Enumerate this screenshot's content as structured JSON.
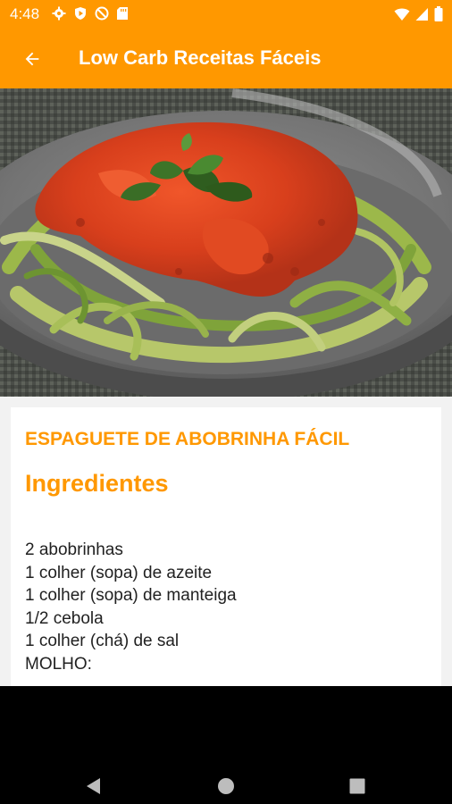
{
  "status_bar": {
    "time": "4:48",
    "left_icons": [
      "gear-icon",
      "shield-play-icon",
      "no-disturb-icon",
      "sd-card-icon"
    ],
    "right_icons": [
      "wifi-icon",
      "signal-icon",
      "battery-icon"
    ]
  },
  "app_bar": {
    "title": "Low Carb Receitas Fáceis",
    "back_icon": "arrow-back-icon"
  },
  "recipe": {
    "image": "zucchini-spaghetti-with-tomato-sauce",
    "name": "ESPAGUETE DE ABOBRINHA FÁCIL",
    "section_title": "Ingredientes",
    "ingredients": [
      "2 abobrinhas",
      "1 colher (sopa) de azeite",
      "1 colher (sopa) de manteiga",
      "1/2 cebola",
      "1 colher (chá) de sal",
      "MOLHO:"
    ]
  },
  "nav_bar": {
    "buttons": [
      "back-triangle-icon",
      "home-circle-icon",
      "recents-square-icon"
    ]
  },
  "colors": {
    "accent": "#FF9800",
    "text": "#212121",
    "background": "#f2f2f2"
  }
}
